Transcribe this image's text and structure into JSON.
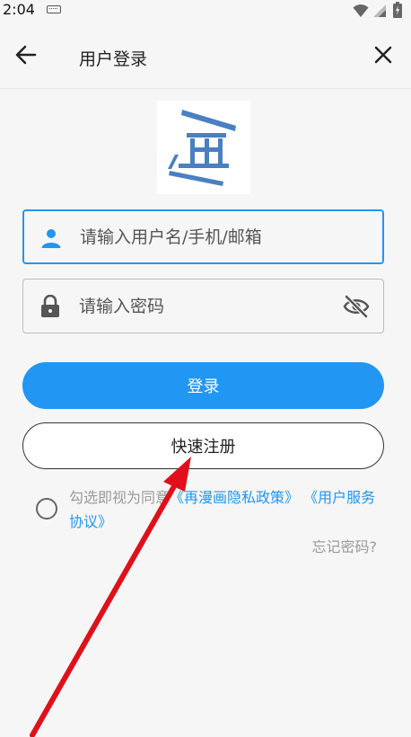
{
  "status_bar": {
    "time": "2:04"
  },
  "app_bar": {
    "title": "用户登录"
  },
  "form": {
    "username_placeholder": "请输入用户名/手机/邮箱",
    "password_placeholder": "请输入密码"
  },
  "buttons": {
    "login": "登录",
    "register": "快速注册"
  },
  "agreement": {
    "prefix": "勾选即视为同意",
    "privacy_link": "《再漫画隐私政策》",
    "terms_link": "《用户服务协议》"
  },
  "forgot_password": "忘记密码?",
  "colors": {
    "accent": "#2196f3",
    "annotation": "#e0101a"
  }
}
